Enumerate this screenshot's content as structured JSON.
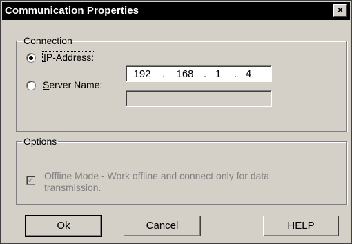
{
  "window": {
    "title": "Communication Properties",
    "close_glyph": "×"
  },
  "connection": {
    "legend": "Connection",
    "ip_option": {
      "hotkey": "I",
      "rest": "P-Address:",
      "selected": true
    },
    "ip_octets": [
      "192",
      "168",
      "1",
      "4"
    ],
    "ip_separator": ".",
    "server_option": {
      "hotkey": "S",
      "rest": "erver Name:",
      "selected": false
    },
    "server_value": ""
  },
  "options": {
    "legend": "Options",
    "offline_mode": {
      "label": "Offline Mode - Work offline and connect only for data transmission.",
      "checked": true,
      "enabled": false
    }
  },
  "buttons": {
    "ok": "Ok",
    "cancel": "Cancel",
    "help": "HELP"
  },
  "colors": {
    "face": "#d4d0c8",
    "title_bg": "#000000",
    "disabled_text": "#808080"
  }
}
